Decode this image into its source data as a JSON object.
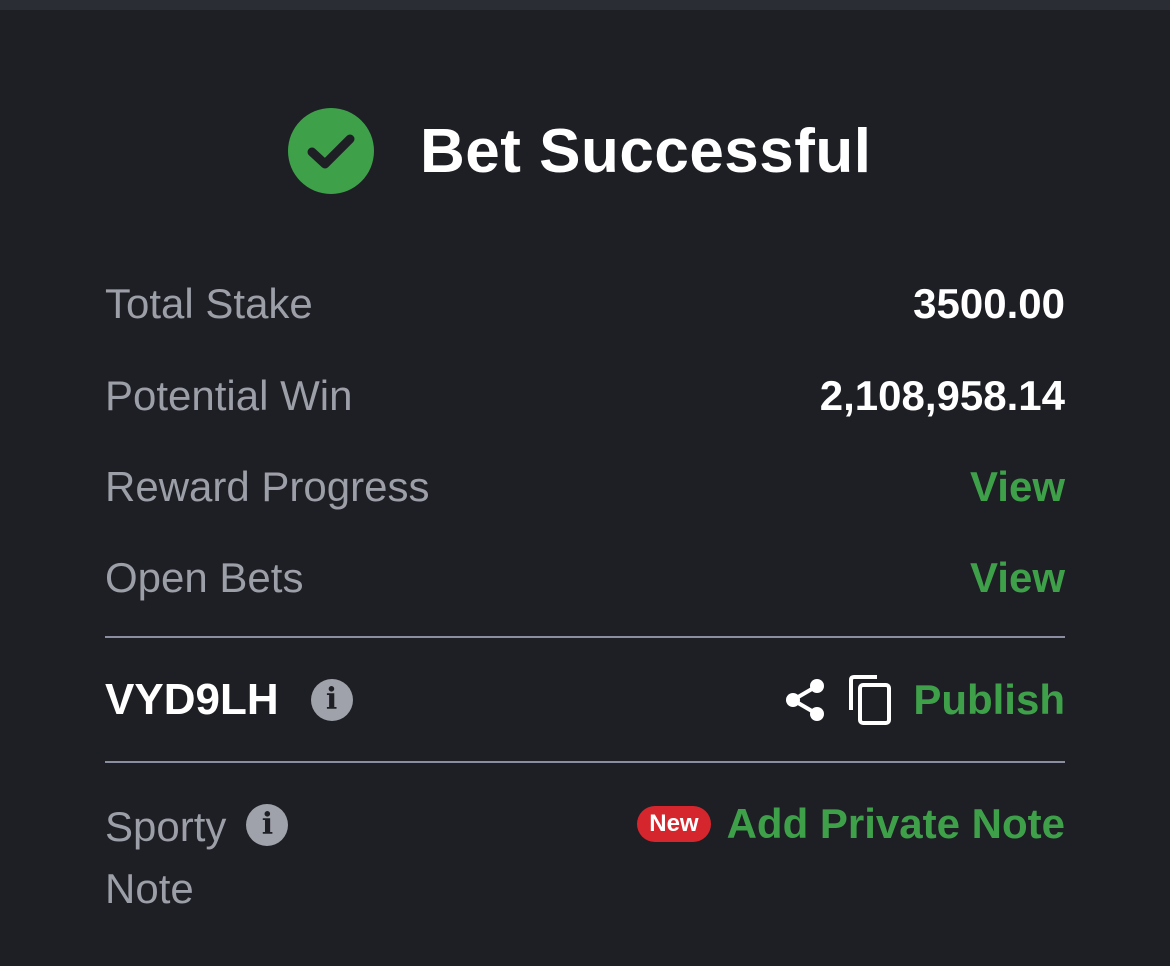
{
  "header": {
    "title": "Bet Successful",
    "status_color": "#3ea14a",
    "icon": "check-circle-icon"
  },
  "summary": {
    "total_stake_label": "Total Stake",
    "total_stake_value": "3500.00",
    "potential_win_label": "Potential Win",
    "potential_win_value": "2,108,958.14",
    "reward_progress_label": "Reward Progress",
    "reward_progress_link": "View",
    "open_bets_label": "Open Bets",
    "open_bets_link": "View"
  },
  "booking": {
    "code": "VYD9LH",
    "info_icon": "info-icon",
    "share_icon": "share-icon",
    "copy_icon": "copy-icon",
    "publish_label": "Publish"
  },
  "note": {
    "label_line1": "Sporty",
    "label_line2": "Note",
    "info_icon": "info-icon",
    "badge": "New",
    "add_label": "Add Private Note"
  },
  "colors": {
    "background": "#1e1f24",
    "accent_green": "#3ea14a",
    "badge_red": "#d6262d",
    "muted_text": "#9c9ea8"
  }
}
